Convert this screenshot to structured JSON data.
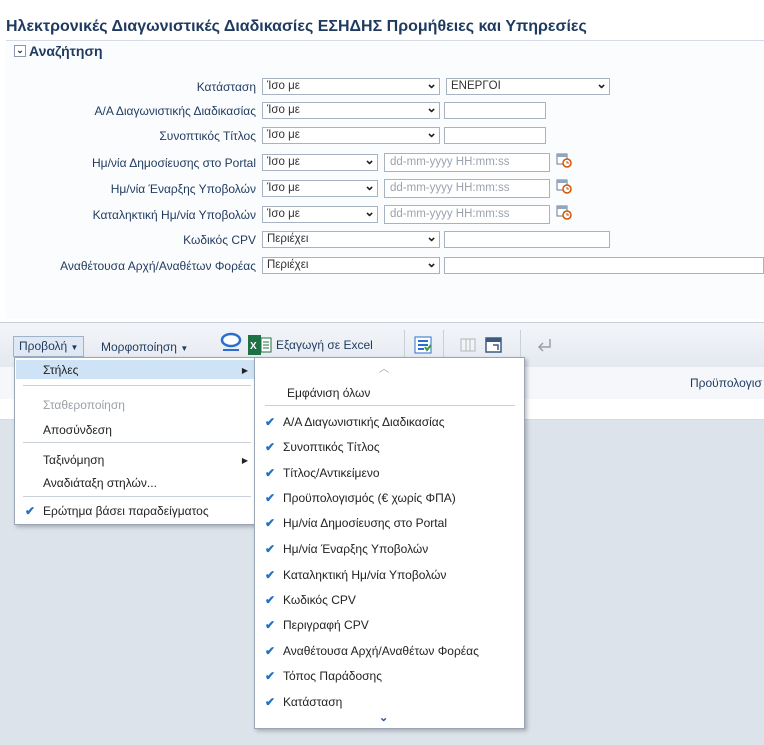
{
  "page": {
    "title": "Ηλεκτρονικές Διαγωνιστικές Διαδικασίες ΕΣΗΔΗΣ Προμήθειες και Υπηρεσίες"
  },
  "search": {
    "title": "Αναζήτηση",
    "fields": [
      {
        "label": "Κατάσταση",
        "operator": "Ίσο με",
        "value": "ΕΝΕΡΓΟΙ"
      },
      {
        "label": "Α/Α Διαγωνιστικής Διαδικασίας",
        "operator": "Ίσο με",
        "value": ""
      },
      {
        "label": "Συνοπτικός Τίτλος",
        "operator": "Ίσο με",
        "value": ""
      },
      {
        "label": "Ημ/νία Δημοσίευσης στο Portal",
        "operator": "Ίσο με",
        "placeholder": "dd-mm-yyyy HH:mm:ss"
      },
      {
        "label": "Ημ/νία Έναρξης Υποβολών",
        "operator": "Ίσο με",
        "placeholder": "dd-mm-yyyy HH:mm:ss"
      },
      {
        "label": "Καταληκτική Ημ/νία Υποβολών",
        "operator": "Ίσο με",
        "placeholder": "dd-mm-yyyy HH:mm:ss"
      },
      {
        "label": "Κωδικός CPV",
        "operator": "Περιέχει",
        "value": ""
      },
      {
        "label": "Αναθέτουσα Αρχή/Αναθέτων Φορέας",
        "operator": "Περιέχει",
        "value": ""
      }
    ]
  },
  "toolbar": {
    "view": "Προβολή",
    "format": "Μορφοποίηση",
    "export": "Εξαγωγή σε Excel"
  },
  "table": {
    "header_partial": "Προϋπολογισ"
  },
  "view_menu": {
    "items": [
      {
        "label": "Στήλες",
        "submenu": true
      },
      {
        "label": "Σταθεροποίηση",
        "disabled": true
      },
      {
        "label": "Αποσύνδεση"
      },
      {
        "label": "Ταξινόμηση",
        "submenu": true
      },
      {
        "label": "Αναδιάταξη στηλών..."
      },
      {
        "label": "Ερώτημα βάσει παραδείγματος",
        "checked": true
      }
    ]
  },
  "columns_menu": {
    "show_all": "Εμφάνιση όλων",
    "items": [
      "Α/Α Διαγωνιστικής Διαδικασίας",
      "Συνοπτικός Τίτλος",
      "Τίτλος/Αντικείμενο",
      "Προϋπολογισμός (€ χωρίς ΦΠΑ)",
      "Ημ/νία Δημοσίευσης στο Portal",
      "Ημ/νία Έναρξης Υποβολών",
      "Καταληκτική Ημ/νία Υποβολών",
      "Κωδικός CPV",
      "Περιγραφή CPV",
      "Αναθέτουσα Αρχή/Αναθέτων Φορέας",
      "Τόπος Παράδοσης",
      "Κατάσταση"
    ]
  },
  "colors": {
    "accent": "#1e73c8",
    "title": "#1f3a5f",
    "highlight": "#cfe3f7"
  }
}
